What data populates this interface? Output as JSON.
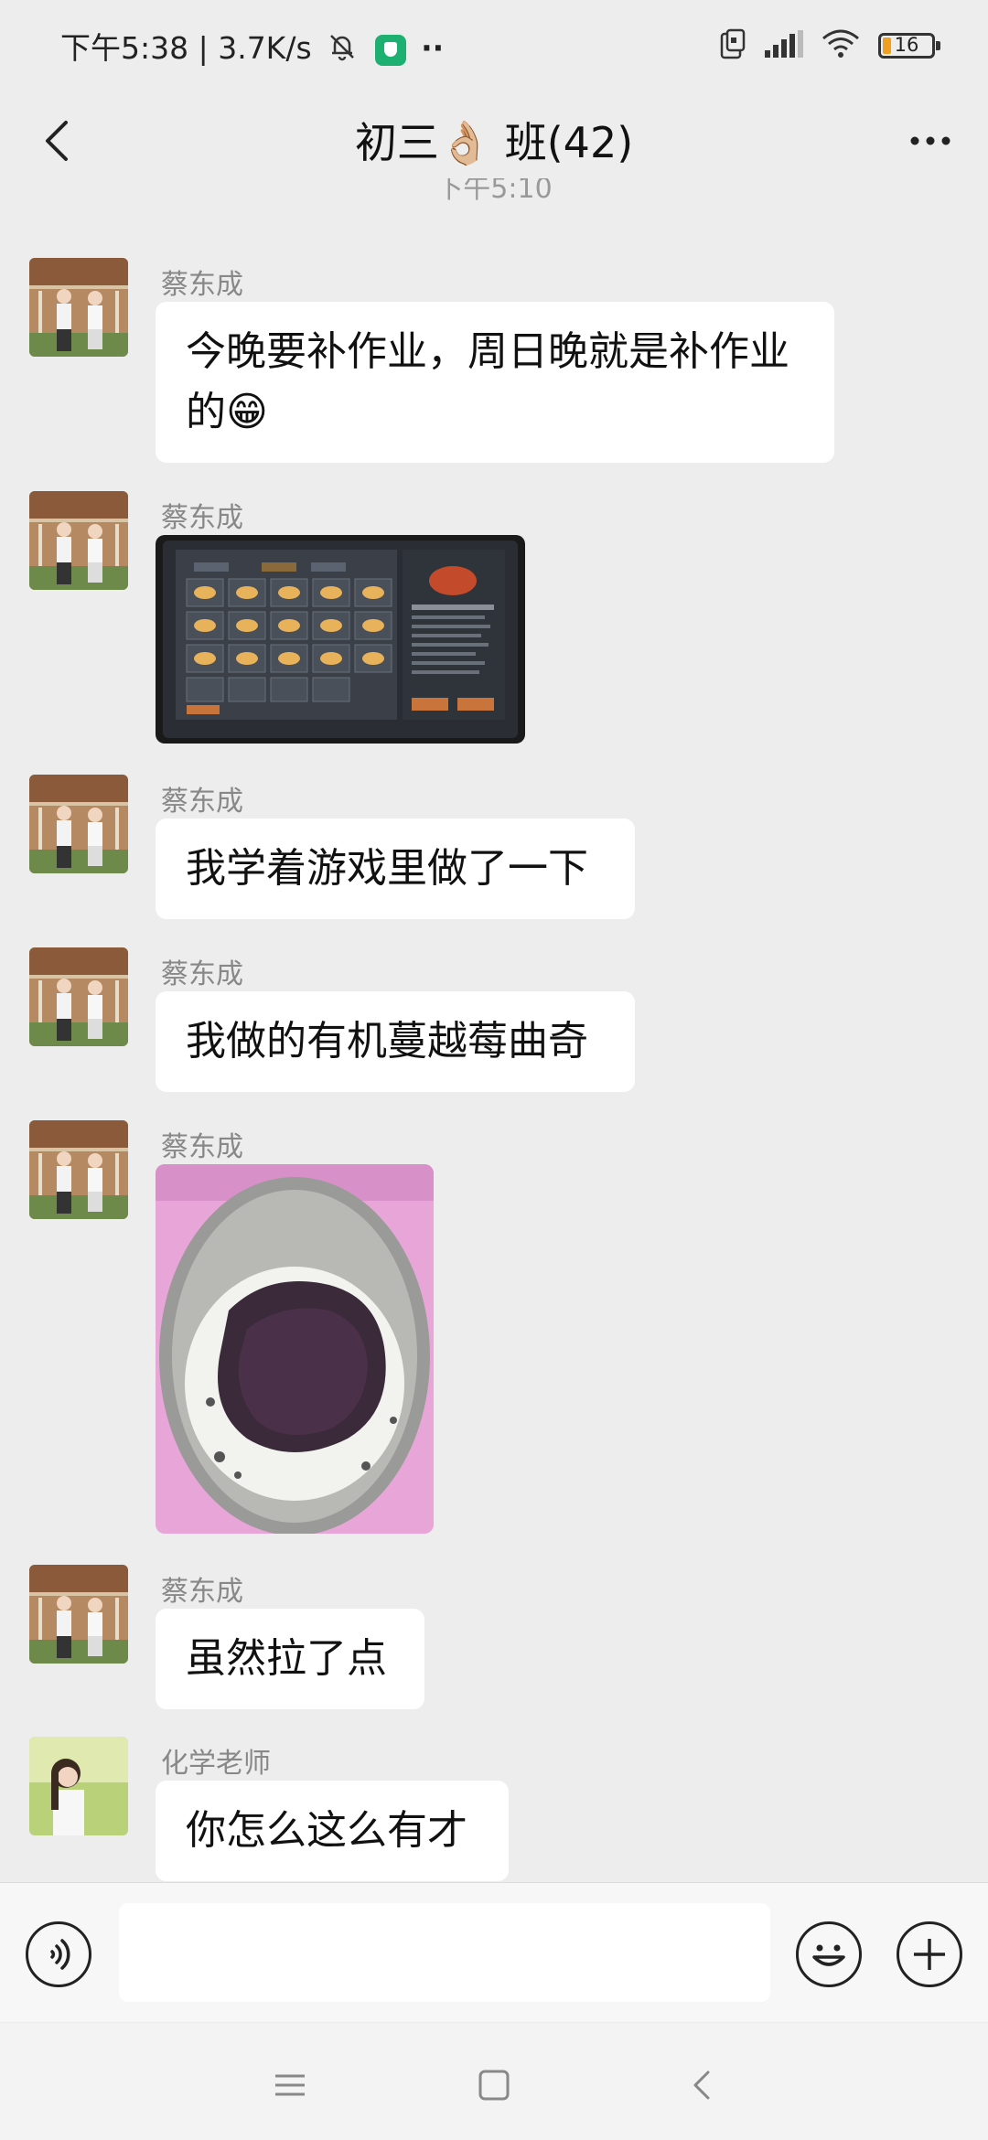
{
  "status_bar": {
    "time_speed": "下午5:38 | 3.7K/s",
    "more": "··",
    "battery_level": "16",
    "battery_fraction": 0.16,
    "battery_accent": "#f0a020"
  },
  "header": {
    "title": "初三👌🏼 班(42)",
    "back_icon": "chevron-left-icon",
    "more_icon": "more-horizontal-icon"
  },
  "time_separator": "下午5:10",
  "messages": [
    {
      "sender": "蔡东成",
      "type": "text",
      "text": "今晚要补作业，周日晚就是补作业的😁"
    },
    {
      "sender": "蔡东成",
      "type": "image",
      "image_description_icon": "game-screenshot-image"
    },
    {
      "sender": "蔡东成",
      "type": "text",
      "text": "我学着游戏里做了一下"
    },
    {
      "sender": "蔡东成",
      "type": "text",
      "text": "我做的有机蔓越莓曲奇"
    },
    {
      "sender": "蔡东成",
      "type": "image",
      "image_description_icon": "cookie-photo-image"
    },
    {
      "sender": "蔡东成",
      "type": "text",
      "text": "虽然拉了点"
    },
    {
      "sender": "化学老师",
      "type": "text",
      "text": "你怎么这么有才"
    }
  ],
  "input_bar": {
    "placeholder": "",
    "value": ""
  },
  "colors": {
    "background": "#ededed",
    "bubble": "#ffffff",
    "sender": "#888888"
  }
}
